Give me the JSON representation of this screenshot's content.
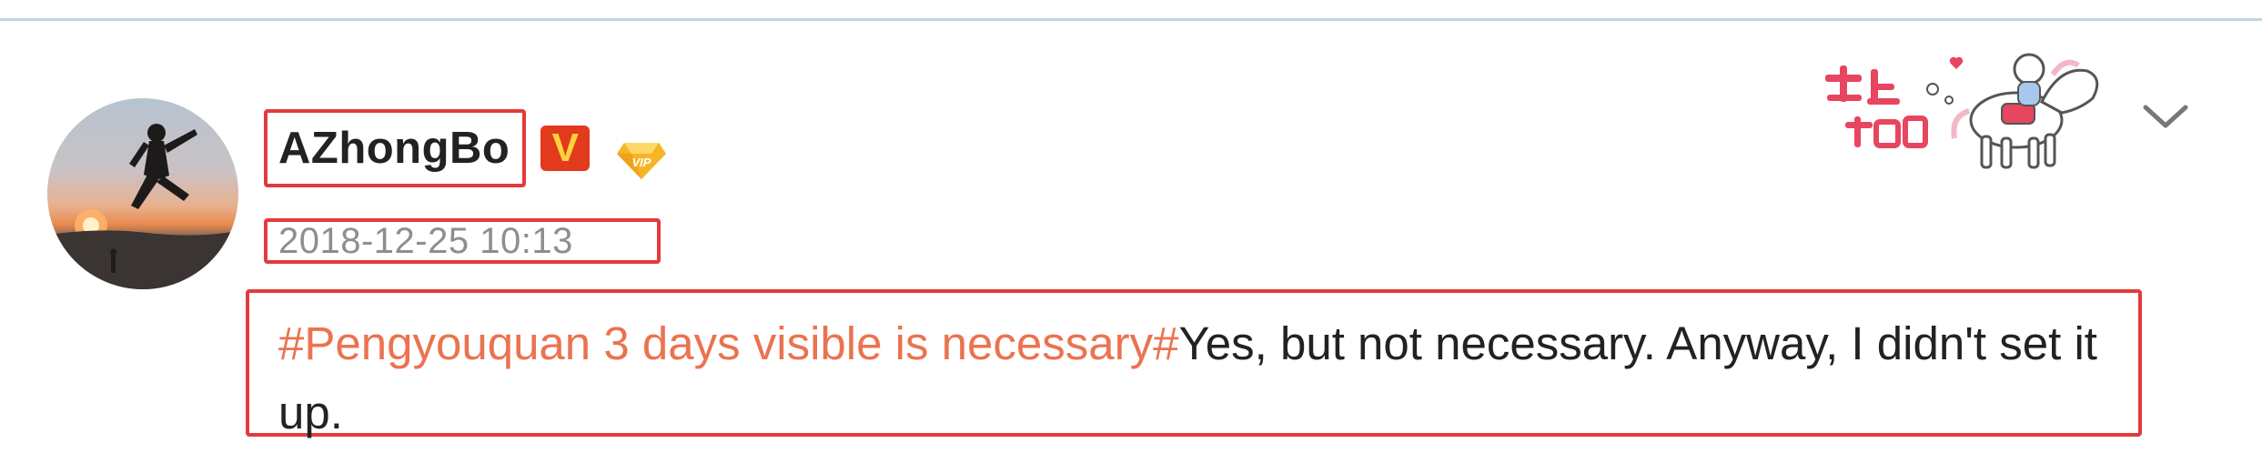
{
  "post": {
    "username": "AZhongBo",
    "verified_badge_letter": "V",
    "vip_icon": "vip-diamond-icon",
    "timestamp": "2018-12-25 10:13",
    "hashtag": "#Pengyouquan 3 days visible is necessary#",
    "body_text": "Yes, but not necessary. Anyway, I didn't set it up.",
    "sticker_icon": "horse-sticker-icon",
    "menu_icon": "chevron-down-icon"
  },
  "colors": {
    "hashtag": "#eb7350",
    "highlight_border": "#e23b3b",
    "verified_badge": "#e23a1c",
    "vip_gold": "#f5b526",
    "divider": "#bcd8e3"
  }
}
